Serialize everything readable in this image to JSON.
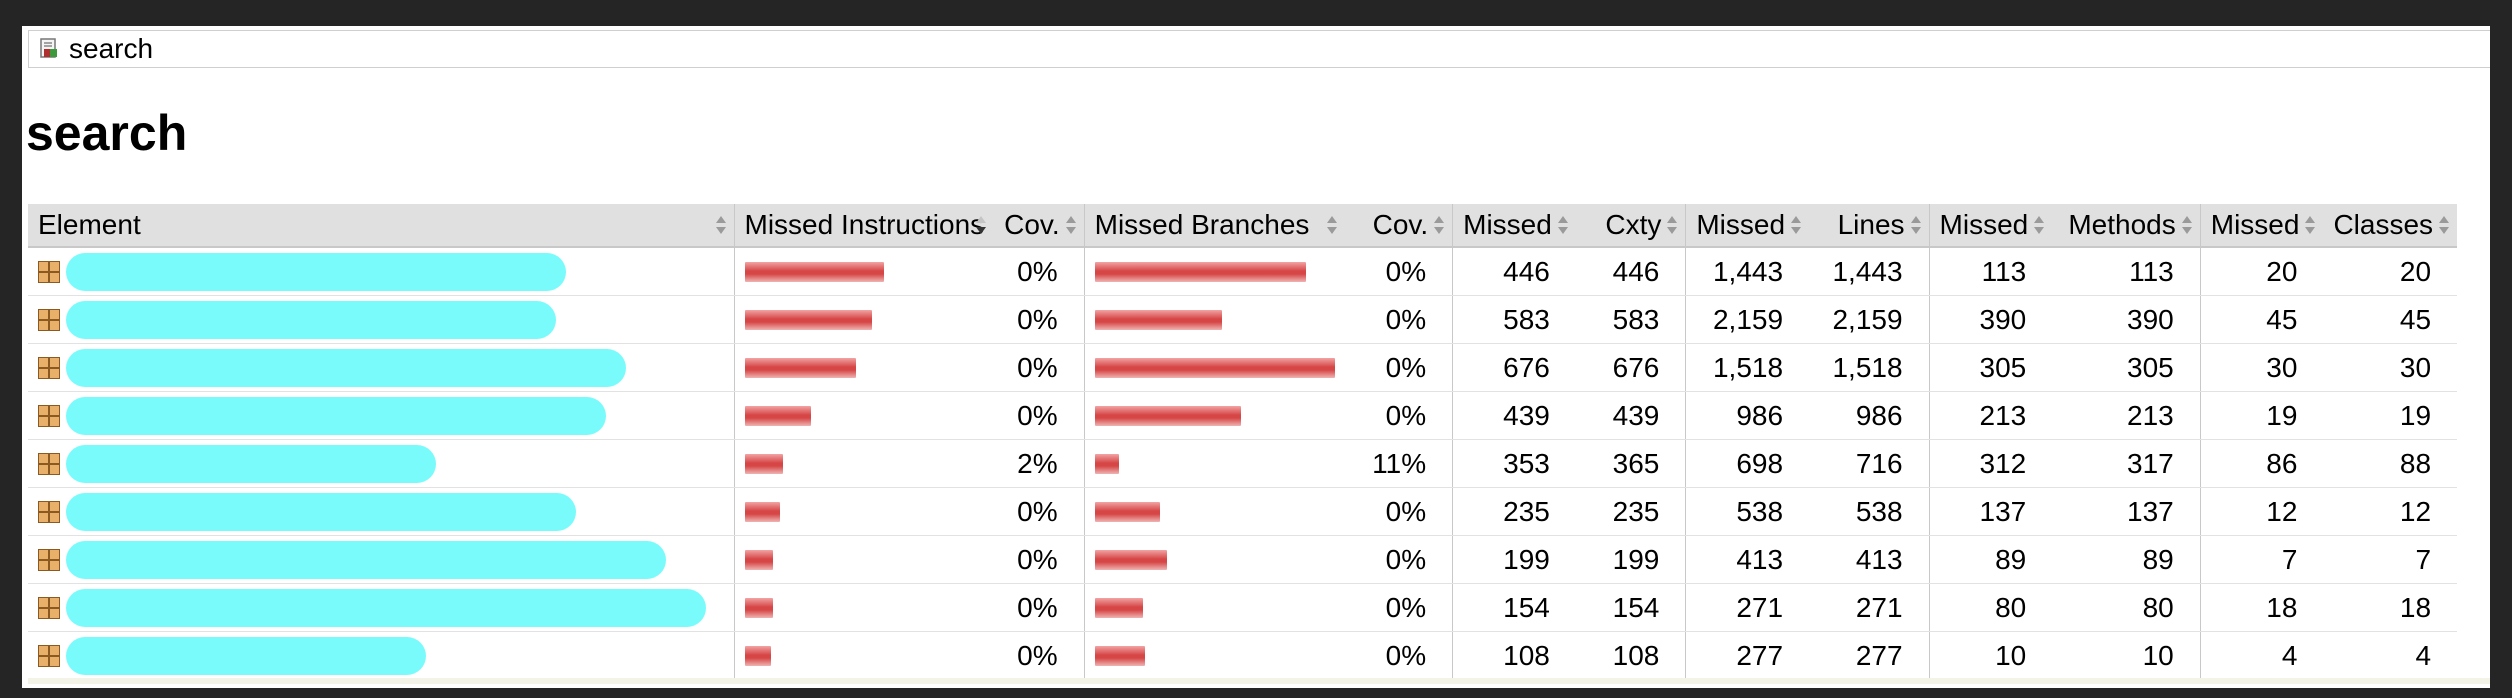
{
  "breadcrumb": {
    "icon": "report-icon",
    "label": "search"
  },
  "title": "search",
  "columns": {
    "element": "Element",
    "missed_instructions": "Missed Instructions",
    "cov_instructions": "Cov.",
    "missed_branches": "Missed Branches",
    "cov_branches": "Cov.",
    "missed_cxty": "Missed",
    "cxty": "Cxty",
    "missed_lines": "Missed",
    "lines": "Lines",
    "missed_methods": "Missed",
    "methods": "Methods",
    "missed_classes": "Missed",
    "classes": "Classes"
  },
  "colors": {
    "bar_red": "#d64646",
    "redaction": "#79fbfb",
    "header_bg": "#e0e0e0"
  },
  "rows": [
    {
      "instr_bar": 0.59,
      "instr_cov": "0%",
      "branch_bar": 0.88,
      "branch_cov": "0%",
      "missed_cxty": "446",
      "cxty": "446",
      "missed_lines": "1,443",
      "lines": "1,443",
      "missed_methods": "113",
      "methods": "113",
      "missed_classes": "20",
      "classes": "20"
    },
    {
      "instr_bar": 0.54,
      "instr_cov": "0%",
      "branch_bar": 0.53,
      "branch_cov": "0%",
      "missed_cxty": "583",
      "cxty": "583",
      "missed_lines": "2,159",
      "lines": "2,159",
      "missed_methods": "390",
      "methods": "390",
      "missed_classes": "45",
      "classes": "45"
    },
    {
      "instr_bar": 0.47,
      "instr_cov": "0%",
      "branch_bar": 1.0,
      "branch_cov": "0%",
      "missed_cxty": "676",
      "cxty": "676",
      "missed_lines": "1,518",
      "lines": "1,518",
      "missed_methods": "305",
      "methods": "305",
      "missed_classes": "30",
      "classes": "30"
    },
    {
      "instr_bar": 0.28,
      "instr_cov": "0%",
      "branch_bar": 0.61,
      "branch_cov": "0%",
      "missed_cxty": "439",
      "cxty": "439",
      "missed_lines": "986",
      "lines": "986",
      "missed_methods": "213",
      "methods": "213",
      "missed_classes": "19",
      "classes": "19"
    },
    {
      "instr_bar": 0.16,
      "instr_cov": "2%",
      "branch_bar": 0.1,
      "branch_cov": "11%",
      "missed_cxty": "353",
      "cxty": "365",
      "missed_lines": "698",
      "lines": "716",
      "missed_methods": "312",
      "methods": "317",
      "missed_classes": "86",
      "classes": "88"
    },
    {
      "instr_bar": 0.15,
      "instr_cov": "0%",
      "branch_bar": 0.27,
      "branch_cov": "0%",
      "missed_cxty": "235",
      "cxty": "235",
      "missed_lines": "538",
      "lines": "538",
      "missed_methods": "137",
      "methods": "137",
      "missed_classes": "12",
      "classes": "12"
    },
    {
      "instr_bar": 0.12,
      "instr_cov": "0%",
      "branch_bar": 0.3,
      "branch_cov": "0%",
      "missed_cxty": "199",
      "cxty": "199",
      "missed_lines": "413",
      "lines": "413",
      "missed_methods": "89",
      "methods": "89",
      "missed_classes": "7",
      "classes": "7"
    },
    {
      "instr_bar": 0.12,
      "instr_cov": "0%",
      "branch_bar": 0.2,
      "branch_cov": "0%",
      "missed_cxty": "154",
      "cxty": "154",
      "missed_lines": "271",
      "lines": "271",
      "missed_methods": "80",
      "methods": "80",
      "missed_classes": "18",
      "classes": "18"
    },
    {
      "instr_bar": 0.11,
      "instr_cov": "0%",
      "branch_bar": 0.21,
      "branch_cov": "0%",
      "missed_cxty": "108",
      "cxty": "108",
      "missed_lines": "277",
      "lines": "277",
      "missed_methods": "10",
      "methods": "10",
      "missed_classes": "4",
      "classes": "4"
    }
  ]
}
